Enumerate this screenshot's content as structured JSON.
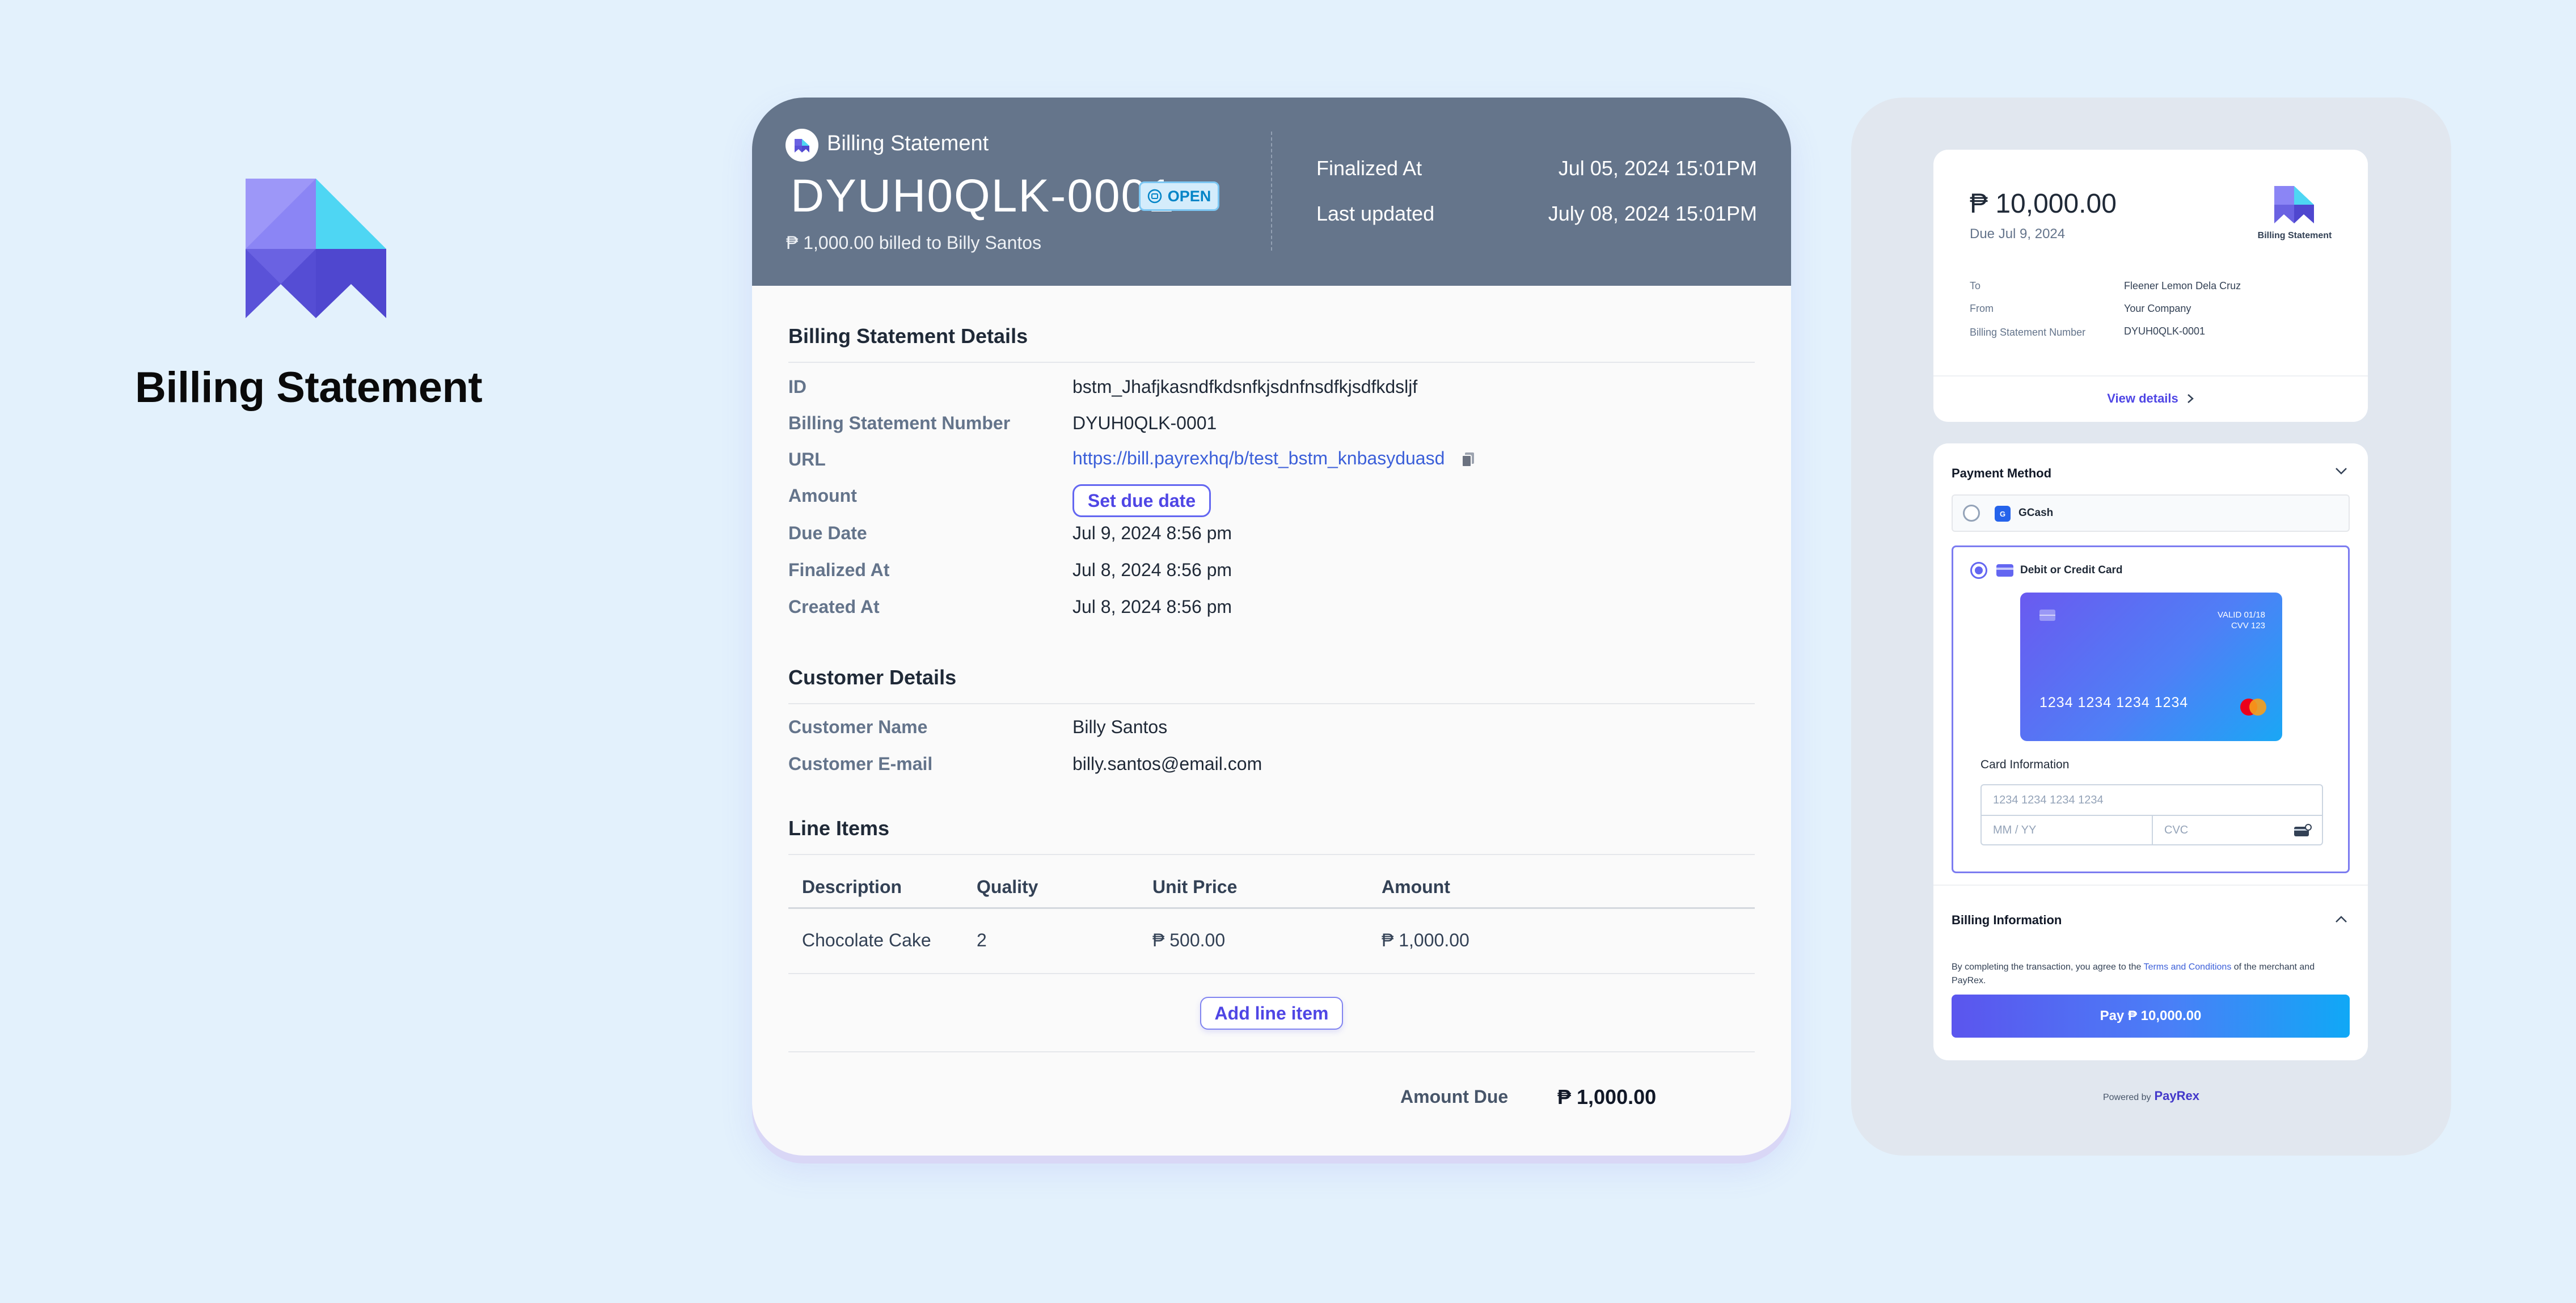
{
  "brand": {
    "title": "Billing Statement"
  },
  "header": {
    "label": "Billing Statement",
    "statement_id": "DYUH0QLK-0001",
    "status": "OPEN",
    "subtitle": "₱ 1,000.00 billed to Billy Santos",
    "finalized_label": "Finalized At",
    "finalized_value": "Jul 05, 2024 15:01PM",
    "updated_label": "Last updated",
    "updated_value": "July 08, 2024 15:01PM"
  },
  "details": {
    "title": "Billing Statement Details",
    "rows": [
      {
        "label": "ID",
        "value": "bstm_Jhafjkasndfkdsnfkjsdnfnsdfkjsdfkdsljf"
      },
      {
        "label": "Billing Statement Number",
        "value": "DYUH0QLK-0001"
      },
      {
        "label": "URL",
        "value": "https://bill.payrexhq/b/test_bstm_knbasyduasd"
      },
      {
        "label": "Amount",
        "value": "Set due date"
      },
      {
        "label": "Due Date",
        "value": "Jul 9, 2024 8:56 pm"
      },
      {
        "label": "Finalized At",
        "value": "Jul 8, 2024 8:56 pm"
      },
      {
        "label": "Created At",
        "value": "Jul 8, 2024 8:56 pm"
      }
    ]
  },
  "customer": {
    "title": "Customer Details",
    "rows": [
      {
        "label": "Customer Name",
        "value": "Billy Santos"
      },
      {
        "label": "Customer E-mail",
        "value": "billy.santos@email.com"
      }
    ]
  },
  "line_items": {
    "title": "Line Items",
    "columns": [
      "Description",
      "Quality",
      "Unit Price",
      "Amount"
    ],
    "rows": [
      {
        "description": "Chocolate Cake",
        "quality": "2",
        "unit_price": "₱ 500.00",
        "amount": "₱ 1,000.00"
      }
    ],
    "add_label": "Add line item",
    "amount_due_label": "Amount Due",
    "amount_due_value": "₱ 1,000.00"
  },
  "summary": {
    "amount": "₱ 10,000.00",
    "due": "Due Jul 9, 2024",
    "logo_text": "Billing Statement",
    "to_label": "To",
    "to_value": "Fleener Lemon Dela Cruz",
    "from_label": "From",
    "from_value": "Your Company",
    "number_label": "Billing Statement Number",
    "number_value": "DYUH0QLK-0001",
    "view_details": "View details"
  },
  "payment": {
    "title": "Payment Method",
    "option_gcash": "GCash",
    "option_card": "Debit or Credit Card",
    "card_valid": "VALID  01/18",
    "card_cvv": "CVV  123",
    "card_number": "1234 1234 1234 1234",
    "card_info_label": "Card Information",
    "card_number_placeholder": "1234 1234 1234 1234",
    "expiry_placeholder": "MM / YY",
    "cvc_placeholder": "CVC",
    "billing_title": "Billing Information",
    "terms_prefix": "By completing the transaction, you agree to the ",
    "terms_link": "Terms and Conditions",
    "terms_suffix": " of the merchant and PayRex.",
    "pay_button": "Pay ₱ 10,000.00",
    "powered_by": "Powered by",
    "powered_brand": "PayRex"
  },
  "colors": {
    "accent": "#6366f1",
    "header_bg": "#65758b",
    "page_bg": "#e3f1fc",
    "status_blue": "#0284c7"
  }
}
